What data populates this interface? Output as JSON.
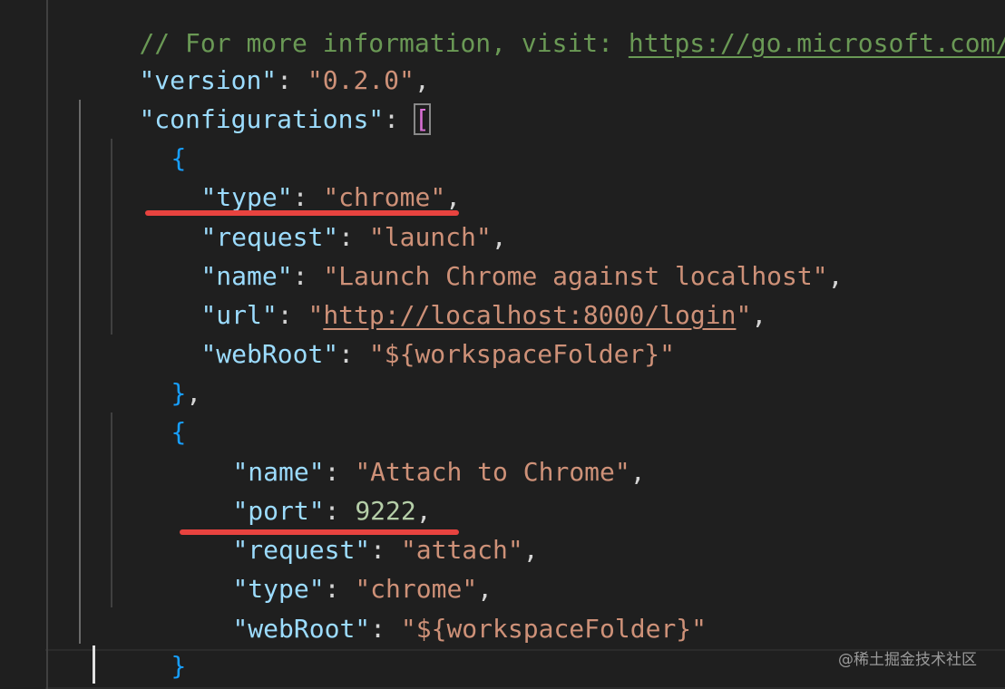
{
  "editor": {
    "lines": {
      "comment": "// For more information, visit: ",
      "comment_url": "https://go.microsoft.com/fw",
      "version_key": "\"version\"",
      "version_val": "\"0.2.0\"",
      "configurations_key": "\"configurations\"",
      "open_bracket": "[",
      "close_bracket": "]",
      "open_brace": "{",
      "close_brace": "}",
      "close_brace_comma": "},",
      "config1": {
        "type_key": "\"type\"",
        "type_val": "\"chrome\"",
        "request_key": "\"request\"",
        "request_val": "\"launch\"",
        "name_key": "\"name\"",
        "name_val": "\"Launch Chrome against localhost\"",
        "url_key": "\"url\"",
        "url_val": "http://localhost:8000/login",
        "webroot_key": "\"webRoot\"",
        "webroot_val": "\"${workspaceFolder}\""
      },
      "config2": {
        "name_key": "\"name\"",
        "name_val": "\"Attach to Chrome\"",
        "port_key": "\"port\"",
        "port_val": "9222",
        "request_key": "\"request\"",
        "request_val": "\"attach\"",
        "type_key": "\"type\"",
        "type_val": "\"chrome\"",
        "webroot_key": "\"webRoot\"",
        "webroot_val": "\"${workspaceFolder}\""
      }
    },
    "annotation_color": "#e8433f"
  },
  "watermark": "@稀土掘金技术社区"
}
